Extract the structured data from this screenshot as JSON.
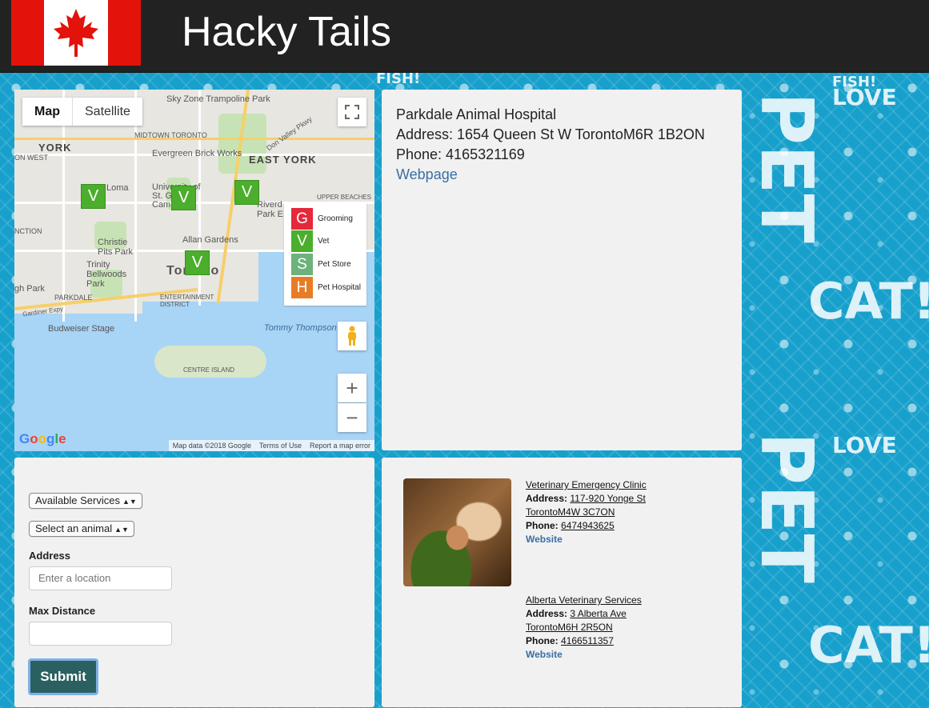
{
  "header": {
    "title": "Hacky Tails"
  },
  "map": {
    "type_buttons": [
      "Map",
      "Satellite"
    ],
    "places": [
      "Sky Zone Trampoline Park",
      "YORK",
      "ON WEST",
      "MIDTOWN TORONTO",
      "Evergreen Brick Works",
      "Don Valley Pkwy",
      "EAST YORK",
      "Loma",
      "University of St. George Campus",
      "Riverd Park E",
      "UPPER BEACHES",
      "Christie Pits Park",
      "Allan Gardens",
      "Trinity Bellwoods Park",
      "Toronto",
      "gh Park",
      "PARKDALE",
      "ENTERTAINMENT DISTRICT",
      "Gardiner Expy",
      "Budweiser Stage",
      "Tommy Thompson",
      "CENTRE ISLAND",
      "NCTION"
    ],
    "markers": [
      "V",
      "V",
      "V",
      "V"
    ],
    "legend": [
      {
        "letter": "G",
        "label": "Grooming",
        "color": "#e5283a"
      },
      {
        "letter": "V",
        "label": "Vet",
        "color": "#4bae2c"
      },
      {
        "letter": "S",
        "label": "Pet Store",
        "color": "#6cb27c"
      },
      {
        "letter": "H",
        "label": "Pet Hospital",
        "color": "#e87c26"
      }
    ],
    "footer": [
      "Map data ©2018 Google",
      "Terms of Use",
      "Report a map error"
    ],
    "logo": "Google"
  },
  "info": {
    "name": "Parkdale Animal Hospital",
    "address": "Address: 1654 Queen St W TorontoM6R 1B2ON",
    "phone": "Phone: 4165321169",
    "link": "Webpage"
  },
  "form": {
    "services_select": "Available Services",
    "animal_select": "Select an animal",
    "address_label": "Address",
    "address_placeholder": "Enter a location",
    "distance_label": "Max Distance",
    "distance_value": "",
    "submit_label": "Submit"
  },
  "results": [
    {
      "name": "Veterinary Emergency Clinic",
      "address_label": "Address:",
      "address_1": "117-920 Yonge St",
      "address_2": "TorontoM4W 3C7ON",
      "phone_label": "Phone:",
      "phone": "6474943625",
      "website": "Website"
    },
    {
      "name": "Alberta Veterinary Services",
      "address_label": "Address:",
      "address_1": "3 Alberta Ave",
      "address_2": "TorontoM6H 2R5ON",
      "phone_label": "Phone:",
      "phone": "4166511357",
      "website": "Website"
    }
  ],
  "background_text": [
    "FISH!",
    "FISH!",
    "LOVE",
    "LOVE",
    "PET",
    "PET",
    "CAT!!",
    "CAT!!"
  ]
}
